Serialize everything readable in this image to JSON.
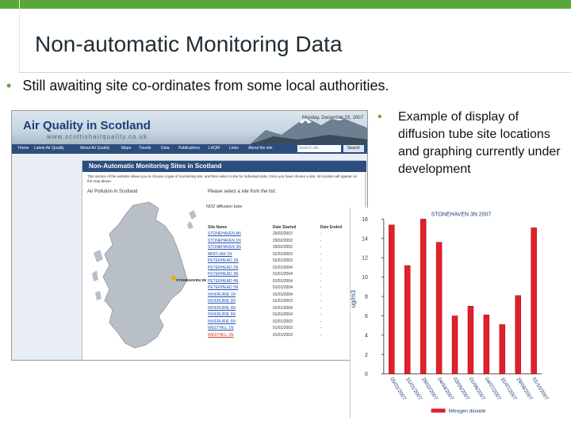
{
  "slide": {
    "title": "Non-automatic Monitoring Data",
    "bullet1": "Still awaiting site co-ordinates from some local authorities.",
    "bullet2": "Example of display of diffusion tube site locations and graphing currently under development",
    "bullet_char": "•",
    "accent_color": "#5aa83a"
  },
  "site": {
    "title": "Air Quality in Scotland",
    "url": "www.scottishairquality.co.uk",
    "date": "Monday, December 03, 2007",
    "nav": [
      "Home",
      "Latest Air Quality",
      "About Air Quality",
      "Maps",
      "Trends",
      "Data",
      "Publications",
      "LAQM",
      "Links",
      "About the site"
    ],
    "search_placeholder": "Search site",
    "search_button": "Search",
    "panel_title": "Non-Automatic Monitoring Sites in Scotland",
    "panel_note": "This section of the website allows you to choose a type of monitoring site, and then select a site for individual data. Once you have chosen a site, its location will appear on the map above.",
    "map_label": "Air Pollution in Scotland",
    "list_label": "Please select a site from the list:",
    "diffusion_label": "NO2 diffusion tube",
    "table_headers": [
      "Site Name",
      "Date Started",
      "Date Ended"
    ],
    "rows": [
      {
        "name": "STONEHAVEN 4N",
        "start": "29/02/2002",
        "end": "-"
      },
      {
        "name": "STONEHAVEN 1N",
        "start": "29/02/2002",
        "end": "-"
      },
      {
        "name": "STONEHAVEN 3N",
        "start": "29/02/2002",
        "end": "-"
      },
      {
        "name": "MINTLAW 1N",
        "start": "01/01/2003",
        "end": "-"
      },
      {
        "name": "PETERHEAD 1N",
        "start": "01/01/2003",
        "end": "-"
      },
      {
        "name": "PETERHEAD 2N",
        "start": "01/01/2004",
        "end": "-"
      },
      {
        "name": "PETERHEAD 3N",
        "start": "01/01/2004",
        "end": "-"
      },
      {
        "name": "PETERHEAD 4N",
        "start": "01/01/2004",
        "end": "-"
      },
      {
        "name": "PETERHEAD 5N",
        "start": "01/01/2004",
        "end": "-"
      },
      {
        "name": "INVERURIE 1N",
        "start": "01/01/2004",
        "end": "-"
      },
      {
        "name": "INVERURIE 3N",
        "start": "01/01/2003",
        "end": "-"
      },
      {
        "name": "INVERURIE 4N",
        "start": "01/01/2004",
        "end": "-"
      },
      {
        "name": "INVERURIE 5N",
        "start": "01/01/2004",
        "end": "-"
      },
      {
        "name": "INVERURIE 6N",
        "start": "01/01/2003",
        "end": "-"
      },
      {
        "name": "WESTHILL 1N",
        "start": "01/01/2003",
        "end": "-"
      },
      {
        "name": "WESTHILL 2N",
        "start": "01/01/2003",
        "end": "-"
      }
    ],
    "highlight_row": 15,
    "marker_label": "STONEHAVEN 3N"
  },
  "chart_data": {
    "type": "bar",
    "title": "STONEHAVEN 3N 2007",
    "ylabel": "ug/m3",
    "xlabel": "",
    "ylim": [
      0,
      16
    ],
    "yticks": [
      0,
      2,
      4,
      6,
      8,
      10,
      12,
      14,
      16
    ],
    "categories": [
      "05/01/2007",
      "31/01/2007",
      "28/02/2007",
      "04/04/2007",
      "03/05/2007",
      "01/06/2007",
      "04/07/2007",
      "31/07/2007",
      "29/08/2007",
      "01/10/2007"
    ],
    "series": [
      {
        "name": "Nitrogen dioxide",
        "values": [
          15.4,
          11.2,
          16.0,
          13.6,
          6.0,
          7.0,
          6.1,
          5.1,
          8.1,
          15.1
        ]
      }
    ],
    "colors": {
      "bar": "#e0202a",
      "axis": "#555555"
    },
    "legend": "bottom"
  }
}
